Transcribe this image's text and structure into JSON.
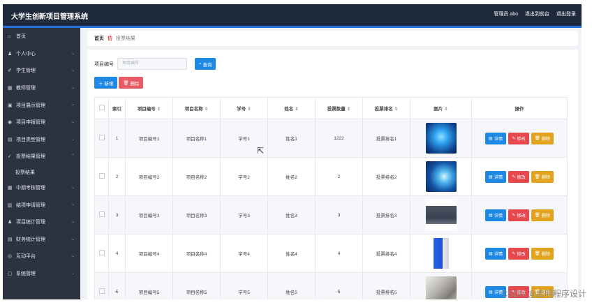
{
  "app": {
    "title": "大学生创新项目管理系统",
    "user_label": "管理员 abo",
    "to_frontend": "退出到前台",
    "logout": "退出登录"
  },
  "sidebar": {
    "items": [
      {
        "icon": "home-icon",
        "glyph": "⌂",
        "label": "首页",
        "has_chevron": false
      },
      {
        "icon": "user-icon",
        "glyph": "♟",
        "label": "个人中心",
        "has_chevron": true
      },
      {
        "icon": "student-icon",
        "glyph": "✐",
        "label": "学生管理",
        "has_chevron": true
      },
      {
        "icon": "teacher-icon",
        "glyph": "▦",
        "label": "教师管理",
        "has_chevron": true
      },
      {
        "icon": "display-icon",
        "glyph": "▣",
        "label": "项目展示管理",
        "has_chevron": true
      },
      {
        "icon": "apply-icon",
        "glyph": "◉",
        "label": "项目申报管理",
        "has_chevron": true
      },
      {
        "icon": "type-icon",
        "glyph": "▤",
        "label": "项目类型管理",
        "has_chevron": true
      },
      {
        "icon": "vote-icon",
        "glyph": "✓",
        "label": "投票结果管理",
        "has_chevron": true
      },
      {
        "icon": "midterm-icon",
        "glyph": "▦",
        "label": "中期考核管理",
        "has_chevron": true
      },
      {
        "icon": "conclusion-icon",
        "glyph": "▥",
        "label": "结项申请管理",
        "has_chevron": true
      },
      {
        "icon": "stat-icon",
        "glyph": "♟",
        "label": "项目统计管理",
        "has_chevron": true
      },
      {
        "icon": "finance-icon",
        "glyph": "▤",
        "label": "财务统计管理",
        "has_chevron": true
      },
      {
        "icon": "interact-icon",
        "glyph": "◎",
        "label": "互动平台",
        "has_chevron": true
      },
      {
        "icon": "system-icon",
        "glyph": "▢",
        "label": "系统管理",
        "has_chevron": true
      }
    ],
    "sub_item": "投票结果"
  },
  "breadcrumb": {
    "home": "首页",
    "separator": "仿",
    "current": "投票结果"
  },
  "search": {
    "label": "项目编号",
    "placeholder": "项目编号",
    "button": "查询"
  },
  "actions": {
    "add": "新增",
    "delete": "删除"
  },
  "table": {
    "headers": [
      "索引",
      "项目编号",
      "项目名称",
      "学号",
      "姓名",
      "投票数量",
      "投票排名",
      "图片",
      "操作"
    ],
    "rows": [
      {
        "index": "1",
        "code": "项目编号1",
        "name": "项目名称1",
        "sid": "学号1",
        "sname": "姓名1",
        "votes": "1222",
        "rank": "投票排名1",
        "pic": "pic1"
      },
      {
        "index": "2",
        "code": "项目编号2",
        "name": "项目名称2",
        "sid": "学号2",
        "sname": "姓名2",
        "votes": "2",
        "rank": "投票排名2",
        "pic": "pic2"
      },
      {
        "index": "3",
        "code": "项目编号3",
        "name": "项目名称3",
        "sid": "学号3",
        "sname": "姓名3",
        "votes": "3",
        "rank": "投票排名3",
        "pic": "pic3"
      },
      {
        "index": "4",
        "code": "项目编号4",
        "name": "项目名称4",
        "sid": "学号4",
        "sname": "姓名4",
        "votes": "4",
        "rank": "投票排名4",
        "pic": "pic4"
      },
      {
        "index": "5",
        "code": "项目编号5",
        "name": "项目名称5",
        "sid": "学号5",
        "sname": "姓名5",
        "votes": "5",
        "rank": "投票排名5",
        "pic": "pic5"
      }
    ],
    "op_detail": "详情",
    "op_edit": "修改",
    "op_delete": "删除"
  },
  "watermark": "CSDN @启明程序设计"
}
